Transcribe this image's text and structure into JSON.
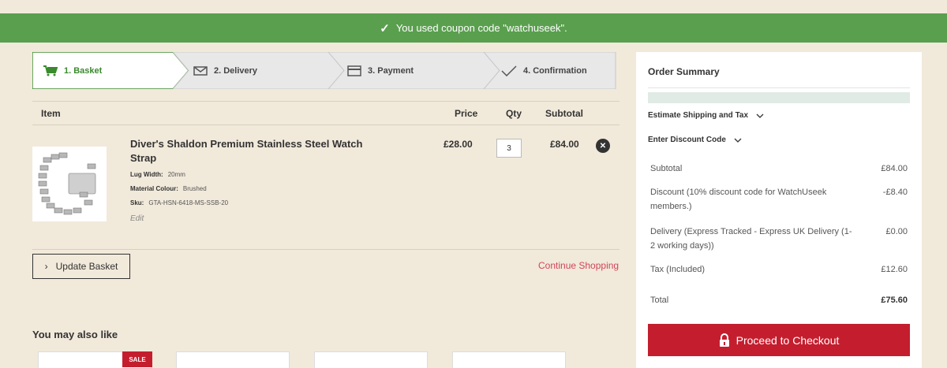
{
  "banner": {
    "message": "You used coupon code \"watchuseek\".",
    "icon": "check-icon"
  },
  "steps": [
    {
      "label": "1. Basket",
      "icon": "cart-icon"
    },
    {
      "label": "2. Delivery",
      "icon": "envelope-icon"
    },
    {
      "label": "3. Payment",
      "icon": "card-icon"
    },
    {
      "label": "4. Confirmation",
      "icon": "check-icon"
    }
  ],
  "table": {
    "headers": {
      "item": "Item",
      "price": "Price",
      "qty": "Qty",
      "subtotal": "Subtotal"
    },
    "rows": [
      {
        "name": "Diver's Shaldon Premium Stainless Steel Watch Strap",
        "lug_width_label": "Lug Width:",
        "lug_width": "20mm",
        "colour_label": "Material Colour:",
        "colour": "Brushed",
        "sku_label": "Sku:",
        "sku": "GTA-HSN-6418-MS-SSB-20",
        "edit": "Edit",
        "price": "£28.00",
        "qty": "3",
        "subtotal": "£84.00"
      }
    ]
  },
  "actions": {
    "update": "Update Basket",
    "continue": "Continue Shopping"
  },
  "also_like": {
    "title": "You may also like",
    "sale_badge": "SALE"
  },
  "summary": {
    "title": "Order Summary",
    "shipping_toggle": "Estimate Shipping and Tax",
    "discount_toggle": "Enter Discount Code",
    "subtotal_label": "Subtotal",
    "subtotal": "£84.00",
    "discount_label": "Discount (10% discount code for WatchUseek members.)",
    "discount": "-£8.40",
    "delivery_label": "Delivery (Express Tracked - Express UK Delivery (1-2 working days))",
    "delivery": "£0.00",
    "tax_label": "Tax (Included)",
    "tax": "£12.60",
    "total_label": "Total",
    "total": "£75.60",
    "checkout": "Proceed to Checkout"
  },
  "colors": {
    "green": "#5a9f4e",
    "red": "#c41e2e",
    "link": "#d0455b",
    "background": "#f1e9da"
  }
}
